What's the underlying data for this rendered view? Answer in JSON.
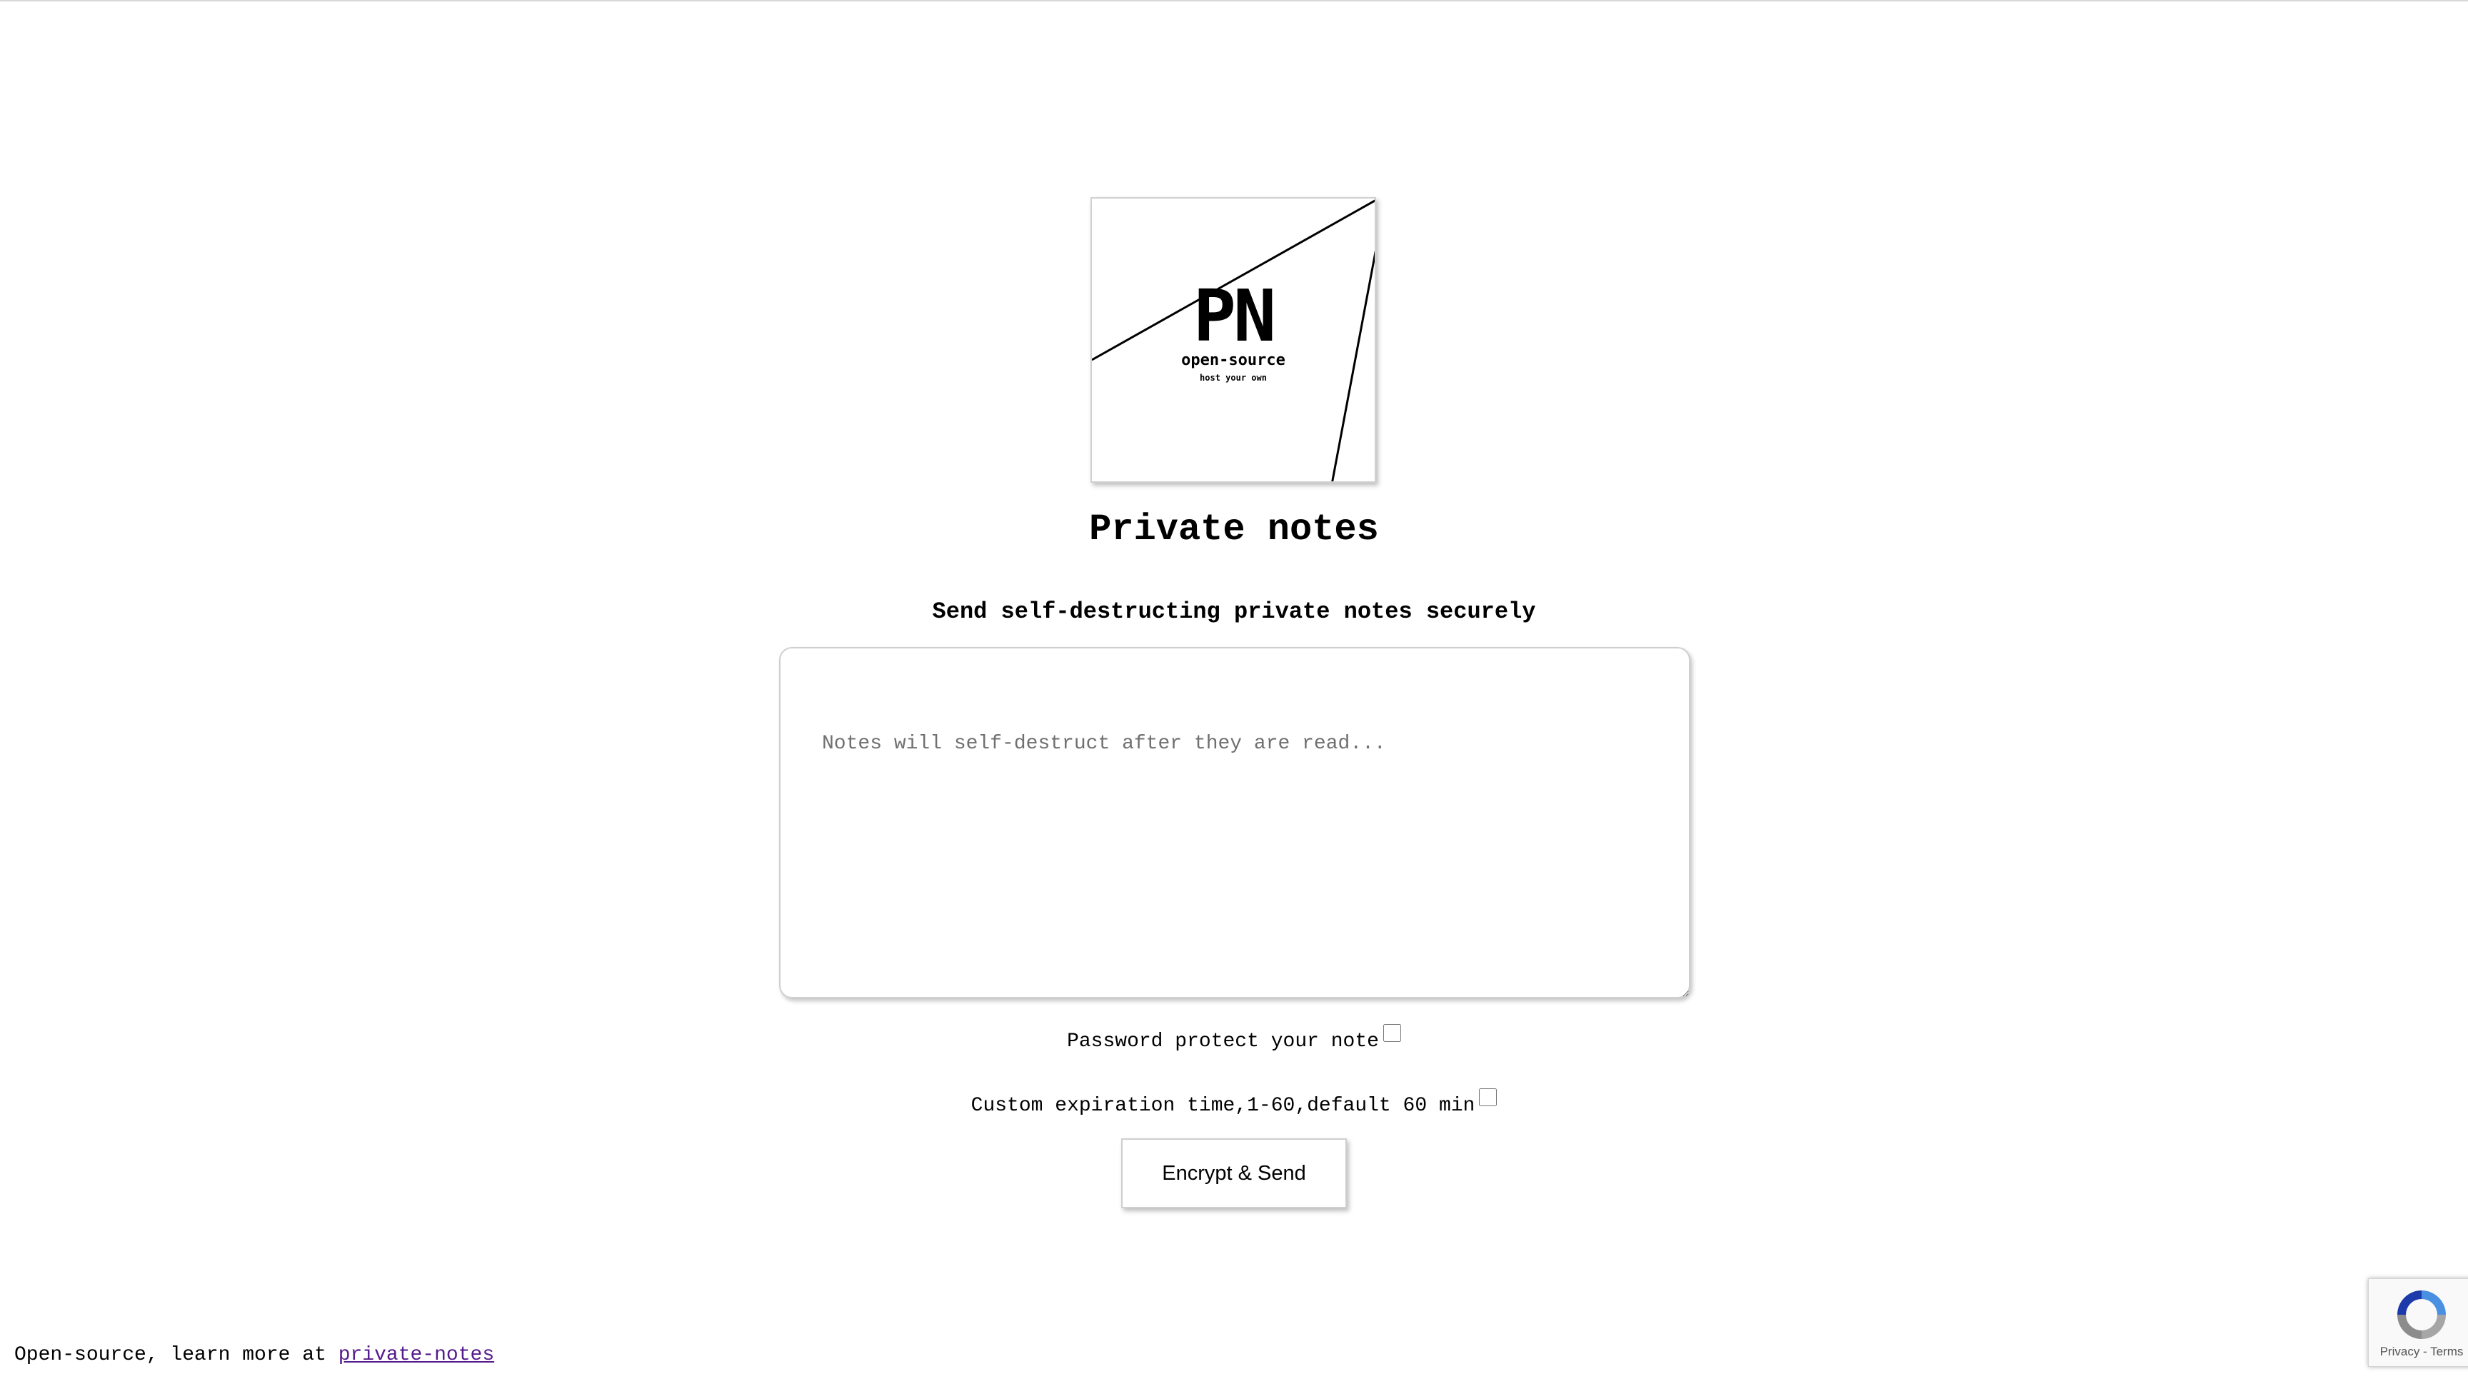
{
  "logo": {
    "mark": "PN",
    "line1": "open-source",
    "line2": "host your own"
  },
  "header": {
    "title": "Private notes",
    "subtitle": "Send self-destructing private notes securely"
  },
  "note": {
    "placeholder": "Notes will self-destruct after they are read...",
    "value": ""
  },
  "options": {
    "password_label": "Password protect your note",
    "password_checked": false,
    "expiration_label": "Custom expiration time,1-60,default 60 min",
    "expiration_checked": false
  },
  "actions": {
    "send_label": "Encrypt & Send"
  },
  "footer": {
    "text": "Open-source, learn more at ",
    "link_label": "private-notes"
  },
  "recaptcha": {
    "links": "Privacy - Terms"
  },
  "colors": {
    "link": "#551a8b",
    "border": "#cfcfcf"
  }
}
